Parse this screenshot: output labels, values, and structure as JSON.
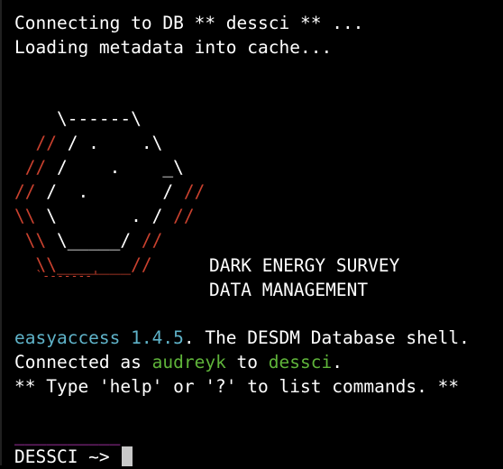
{
  "terminal": {
    "line_connecting": "Connecting to DB ** dessci ** ...",
    "line_loading": "Loading metadata into cache...",
    "art": [
      {
        "w1": "    \\------\\",
        "r1": "",
        "w2": "",
        "r2": ""
      },
      {
        "w1": "",
        "r1": "  // ",
        "w2": "/ .    .\\",
        "r2": ""
      },
      {
        "w1": "",
        "r1": " // ",
        "w2": "/    .    _\\",
        "r2": ""
      },
      {
        "w1": "",
        "r1": "// ",
        "w2": "/  .       / ",
        "r2": "//"
      },
      {
        "w1": "",
        "r1": "\\\\ ",
        "w2": "\\       . / ",
        "r2": "//"
      },
      {
        "w1": "",
        "r1": " \\\\ ",
        "w2": "\\_____/ ",
        "r2": "//"
      },
      {
        "w1": "",
        "r1": "  \\\\_______//",
        "w2": "",
        "r2": ""
      },
      {
        "w1": "",
        "r1": "   `-------'",
        "w2": "",
        "r2": ""
      }
    ],
    "survey_line1": "DARK ENERGY SURVEY",
    "survey_line2": "DATA MANAGEMENT",
    "version_app": "easyaccess 1.4.5",
    "version_rest": ". The DESDM Database shell.",
    "connected_prefix": "Connected as ",
    "connected_user": "audreyk",
    "connected_mid": " to ",
    "connected_db": "dessci",
    "connected_suffix": ".",
    "help_line": "** Type 'help' or '?' to list commands. **",
    "separator": "__________",
    "prompt": "DESSCI ~> "
  },
  "colors": {
    "background": "#000000",
    "text": "#ffffff",
    "logo_red": "#c9412e",
    "accent_cyan": "#5fb3c9",
    "accent_green": "#5fb43a",
    "separator_magenta": "#c83cc8"
  }
}
